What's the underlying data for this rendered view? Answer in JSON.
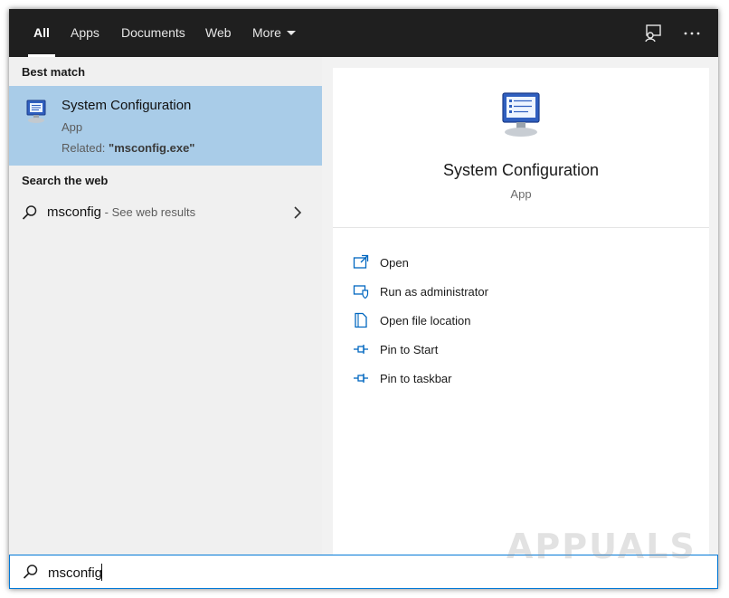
{
  "tabs": [
    {
      "label": "All",
      "active": true
    },
    {
      "label": "Apps",
      "active": false
    },
    {
      "label": "Documents",
      "active": false
    },
    {
      "label": "Web",
      "active": false
    },
    {
      "label": "More",
      "active": false
    }
  ],
  "top_icons": [
    "feedback-icon",
    "more-options-icon"
  ],
  "left": {
    "best_match_title": "Best match",
    "best_match": {
      "name": "System Configuration",
      "type": "App",
      "related_prefix": "Related: ",
      "related_value": "\"msconfig.exe\"",
      "icon": "system-configuration-icon"
    },
    "search_web_title": "Search the web",
    "web_result": {
      "query": "msconfig",
      "suffix": " - See web results",
      "icon": "search-icon"
    }
  },
  "preview": {
    "name": "System Configuration",
    "type": "App",
    "actions": [
      {
        "label": "Open",
        "icon": "open-icon"
      },
      {
        "label": "Run as administrator",
        "icon": "run-as-admin-icon"
      },
      {
        "label": "Open file location",
        "icon": "file-location-icon"
      },
      {
        "label": "Pin to Start",
        "icon": "pin-icon"
      },
      {
        "label": "Pin to taskbar",
        "icon": "pin-icon"
      }
    ]
  },
  "search": {
    "value": "msconfig"
  },
  "watermark": "APPUALS",
  "colors": {
    "accent": "#0078d7",
    "selection": "#a9cce8",
    "topbar": "#1f1f1f"
  }
}
